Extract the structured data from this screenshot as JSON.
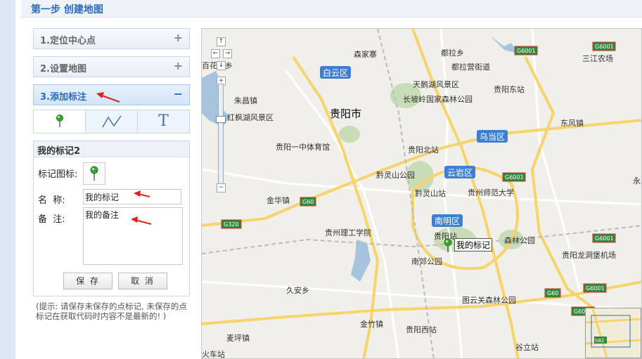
{
  "page": {
    "title": "第一步 创建地图"
  },
  "accordion": [
    {
      "label": "1.定位中心点",
      "sign": "+"
    },
    {
      "label": "2.设置地图",
      "sign": "+"
    },
    {
      "label": "3.添加标注",
      "sign": "−"
    }
  ],
  "tools": {
    "text_tool": "T",
    "pin_icon": "marker-pin-icon",
    "line_icon": "polyline-icon"
  },
  "marker_form": {
    "title": "我的标记2",
    "icon_label": "标记图标:",
    "name_label": "名  称:",
    "name_value": "我的标记",
    "note_label": "备  注:",
    "note_value": "我的备注",
    "save": "保 存",
    "cancel": "取 消"
  },
  "hint": "(提示: 请保存未保存的点标记, 未保存的点标记在获取代码时内容不是最新的! )",
  "map": {
    "marker_label": "我的标记",
    "districts": [
      "白云区",
      "乌当区",
      "云岩区",
      "南明区"
    ],
    "places": [
      "森家寨",
      "都拉乡",
      "都拉营街道",
      "天鹅湖风景区",
      "贵阳东站",
      "长坡岭国家森林公园",
      "朱昌镇",
      "百花湖乡",
      "红枫湖风景区",
      "贵阳市",
      "三江农场",
      "东风镇",
      "贵阳一中体育馆",
      "贵阳北站",
      "黔灵山公园",
      "黔灵山站",
      "贵州师范大学",
      "金华镇",
      "贵州理工学院",
      "贵阳站",
      "森林公园",
      "南郊公园",
      "贵阳龙洞堡机场",
      "久安乡",
      "图云关森林公园",
      "黔灵山公园",
      "金竹镇",
      "贵阳西站",
      "谷立站",
      "麦坪镇",
      "火车站",
      "永乐"
    ],
    "road_shields": [
      "G6001",
      "G6001",
      "G60",
      "G320",
      "G6001",
      "G6001",
      "G6001",
      "G60",
      "G6001",
      "S82"
    ],
    "controls": {
      "up": "↑",
      "left": "←",
      "right": "→",
      "down": "↓",
      "zoom_in": "+",
      "zoom_out": "−"
    }
  },
  "colors": {
    "accent": "#2a6bb8",
    "arrow": "#e02020",
    "district": "#3f7fd0",
    "motorway": "#f6d36b",
    "water": "#a7c4de",
    "park": "#c8ddb7"
  }
}
